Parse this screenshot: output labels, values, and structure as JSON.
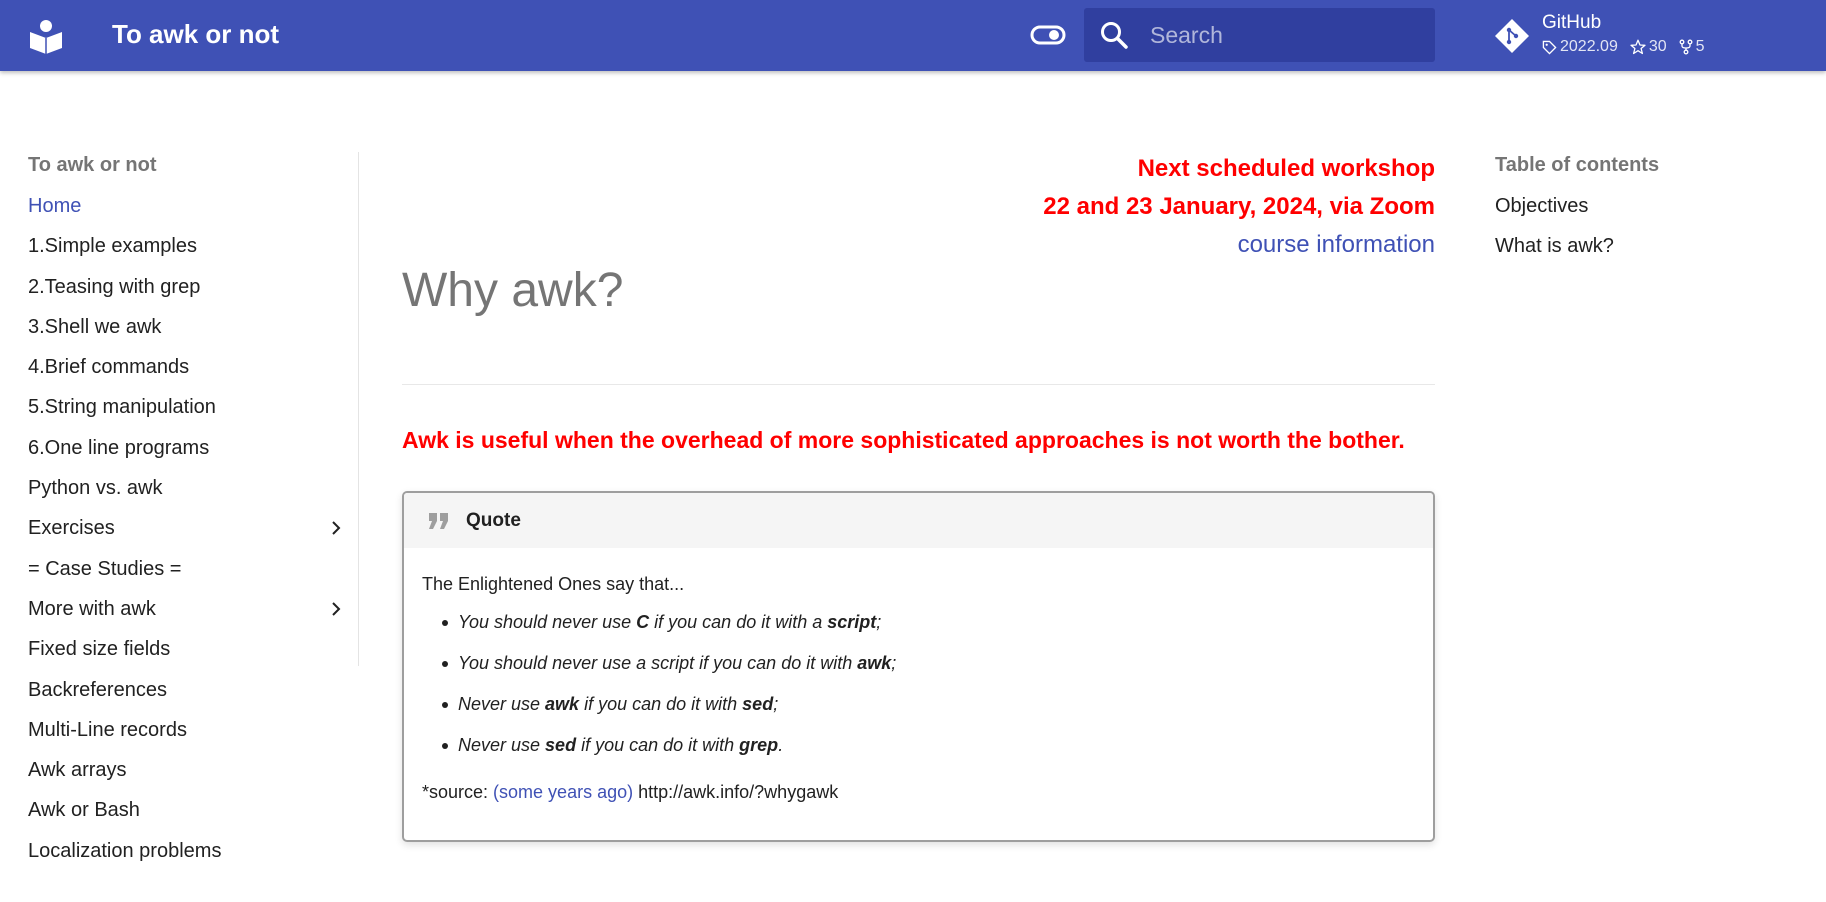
{
  "header": {
    "site_title": "To awk or not",
    "search_placeholder": "Search",
    "repo": {
      "name": "GitHub",
      "version": "2022.09",
      "stars": "30",
      "forks": "5"
    }
  },
  "sidebar": {
    "title": "To awk or not",
    "items": [
      {
        "label": "Home",
        "active": true
      },
      {
        "label": "1.Simple examples"
      },
      {
        "label": "2.Teasing with grep"
      },
      {
        "label": "3.Shell we awk"
      },
      {
        "label": "4.Brief commands"
      },
      {
        "label": "5.String manipulation"
      },
      {
        "label": "6.One line programs"
      },
      {
        "label": "Python vs. awk"
      },
      {
        "label": "Exercises",
        "expandable": true
      },
      {
        "label": "= Case Studies ="
      },
      {
        "label": "More with awk",
        "expandable": true
      },
      {
        "label": "Fixed size fields"
      },
      {
        "label": "Backreferences"
      },
      {
        "label": "Multi-Line records"
      },
      {
        "label": "Awk arrays"
      },
      {
        "label": "Awk or Bash"
      },
      {
        "label": "Localization problems"
      }
    ]
  },
  "announcement": {
    "line1": "Next scheduled workshop",
    "line2": "22 and 23 January, 2024, via Zoom",
    "link": "course information"
  },
  "main": {
    "title": "Why awk?",
    "lead": "Awk is useful when the overhead of more sophisticated approaches is not worth the bother.",
    "quote": {
      "label": "Quote",
      "intro": "The Enlightened Ones say that...",
      "items": [
        {
          "a": "You should never use ",
          "b1": "C",
          "c": " if you can do it with a ",
          "b2": "script",
          "d": ";"
        },
        {
          "a": "You should never use a script if you can do it with ",
          "b1": "awk",
          "c": "",
          "b2": "",
          "d": ";"
        },
        {
          "a": "Never use ",
          "b1": "awk",
          "c": " if you can do it with ",
          "b2": "sed",
          "d": ";"
        },
        {
          "a": "Never use ",
          "b1": "sed",
          "c": " if you can do it with ",
          "b2": "grep",
          "d": "."
        }
      ],
      "source_prefix": "*source: ",
      "source_link": "(some years ago)",
      "source_url": " http://awk.info/?whygawk"
    }
  },
  "toc": {
    "title": "Table of contents",
    "items": [
      "Objectives",
      "What is awk?"
    ]
  },
  "colors": {
    "primary": "#3f51b5",
    "primary_dark": "#303f9f",
    "alert": "#ff0000"
  }
}
